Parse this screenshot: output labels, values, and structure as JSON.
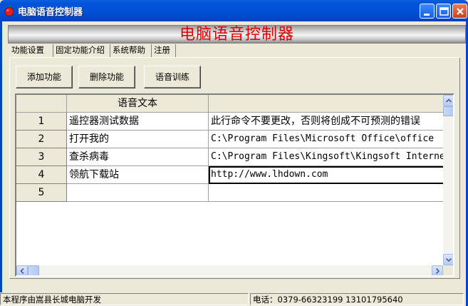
{
  "window": {
    "title": "电脑语音控制器",
    "banner_title": "电脑语音控制器"
  },
  "tabs": [
    {
      "label": "功能设置",
      "active": true
    },
    {
      "label": "固定功能介绍"
    },
    {
      "label": "系统帮助"
    },
    {
      "label": "注册"
    }
  ],
  "toolbar": {
    "add_label": "添加功能",
    "delete_label": "删除功能",
    "train_label": "语音训练"
  },
  "grid": {
    "headers": [
      "",
      "语音文本",
      ""
    ],
    "rows": [
      {
        "num": "1",
        "text": "遥控器测试数据",
        "command": "此行命令不要更改，否则将创成不可预测的错误"
      },
      {
        "num": "2",
        "text": "打开我的",
        "command": "C:\\Program Files\\Microsoft Office\\office"
      },
      {
        "num": "3",
        "text": "查杀病毒",
        "command": "C:\\Program Files\\Kingsoft\\Kingsoft Internet"
      },
      {
        "num": "4",
        "text": "领航下载站",
        "command": "http://www.lhdown.com"
      },
      {
        "num": "5",
        "text": "",
        "command": ""
      }
    ]
  },
  "status": {
    "developer": "本程序由嵩县长城电脑开发",
    "phone": "电话：0379-66323199  13101795640"
  },
  "colors": {
    "titlebar": "#0050d8",
    "banner_text": "#e00000",
    "window_bg": "#ece9d8"
  },
  "icons": [
    "apple-icon",
    "minimize-icon",
    "maximize-icon",
    "close-icon",
    "scroll-up-icon",
    "scroll-down-icon",
    "scroll-left-icon",
    "scroll-right-icon"
  ]
}
